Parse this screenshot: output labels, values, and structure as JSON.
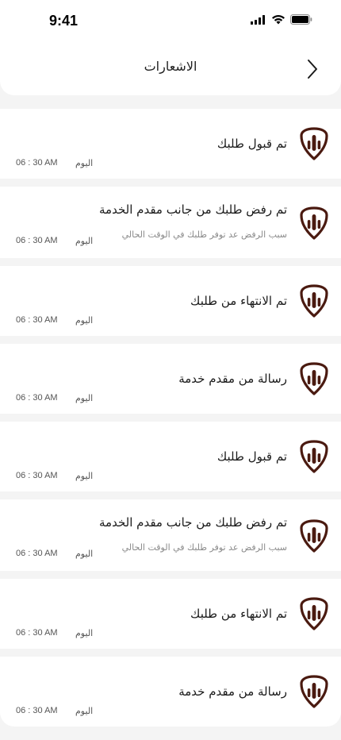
{
  "status_bar": {
    "time": "9:41"
  },
  "header": {
    "title": "الاشعارات"
  },
  "notifications": [
    {
      "title": "تم قبول طلبك",
      "subtitle": "",
      "day": "اليوم",
      "time": "06 : 30 AM"
    },
    {
      "title": "تم رفض طلبك من جانب مقدم الخدمة",
      "subtitle": "سبب الرفض عد توفر طلبك في الوقت الحالي",
      "day": "اليوم",
      "time": "06 : 30 AM"
    },
    {
      "title": "تم الانتهاء من طلبك",
      "subtitle": "",
      "day": "اليوم",
      "time": "06 : 30 AM"
    },
    {
      "title": "رسالة من مقدم خدمة",
      "subtitle": "",
      "day": "اليوم",
      "time": "06 : 30 AM"
    },
    {
      "title": "تم قبول طلبك",
      "subtitle": "",
      "day": "اليوم",
      "time": "06 : 30 AM"
    },
    {
      "title": "تم رفض طلبك من جانب مقدم الخدمة",
      "subtitle": "سبب الرفض عد توفر طلبك في الوقت الحالي",
      "day": "اليوم",
      "time": "06 : 30 AM"
    },
    {
      "title": "تم الانتهاء من طلبك",
      "subtitle": "",
      "day": "اليوم",
      "time": "06 : 30 AM"
    },
    {
      "title": "رسالة من مقدم خدمة",
      "subtitle": "",
      "day": "اليوم",
      "time": "06 : 30 AM"
    }
  ],
  "icons": {
    "back": "chevron-right-icon",
    "notification": "brand-shield-icon",
    "signal": "signal-icon",
    "wifi": "wifi-icon",
    "battery": "battery-icon"
  },
  "colors": {
    "brand": "#4a1a10",
    "background": "#f4f4f4",
    "card": "#ffffff"
  }
}
